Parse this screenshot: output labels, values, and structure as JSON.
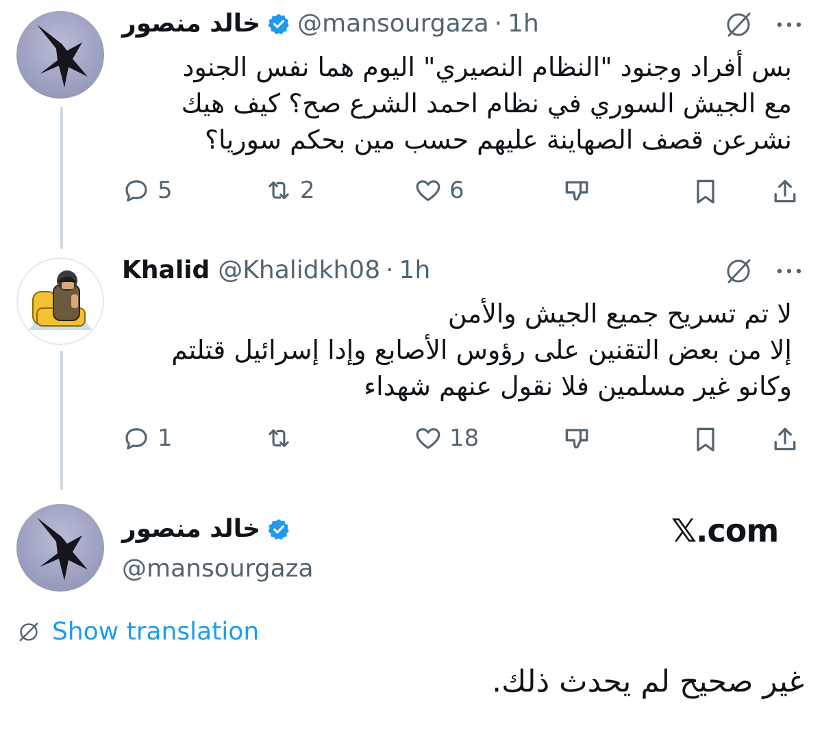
{
  "tweets": [
    {
      "name": "خالد منصور",
      "handle": "@mansourgaza",
      "separator": "·",
      "time": "1h",
      "lines": [
        "بس أفراد وجنود \"النظام النصيري\" اليوم هما نفس الجنود",
        "مع الجيش السوري في نظام احمد الشرع صح؟ كيف هيك",
        "نشرعن قصف الصهاينة عليهم حسب مين بحكم سوريا؟"
      ],
      "replies": "5",
      "reposts": "2",
      "likes": "6"
    },
    {
      "name": "Khalid",
      "handle": "@Khalidkh08",
      "separator": "·",
      "time": "1h",
      "lines": [
        "لا تم تسريح جميع الجيش والأمن",
        "إلا من بعض التقنين على رؤوس الأصابع وإدا إسرائيل قتلتم",
        "وكانو غير مسلمين فلا نقول عنهم شهداء"
      ],
      "replies": "1",
      "reposts": "",
      "likes": "18"
    }
  ],
  "main_tweet": {
    "name": "خالد منصور",
    "handle": "@mansourgaza",
    "site": "𝕏.com",
    "show_translation": "Show translation",
    "text": "غير صحيح لم يحدث ذلك."
  },
  "icons": {
    "verified": "verified-badge-icon",
    "grok": "grok-icon",
    "more": "more-icon",
    "reply": "reply-icon",
    "repost": "repost-icon",
    "like": "heart-icon",
    "dislike": "dislike-icon",
    "bookmark": "bookmark-icon",
    "share": "share-icon",
    "translate": "translate-icon"
  },
  "colors": {
    "link": "#1d9bf0",
    "muted": "#536471",
    "thread_line": "#cfd9de",
    "verified": "#1d9bf0"
  }
}
